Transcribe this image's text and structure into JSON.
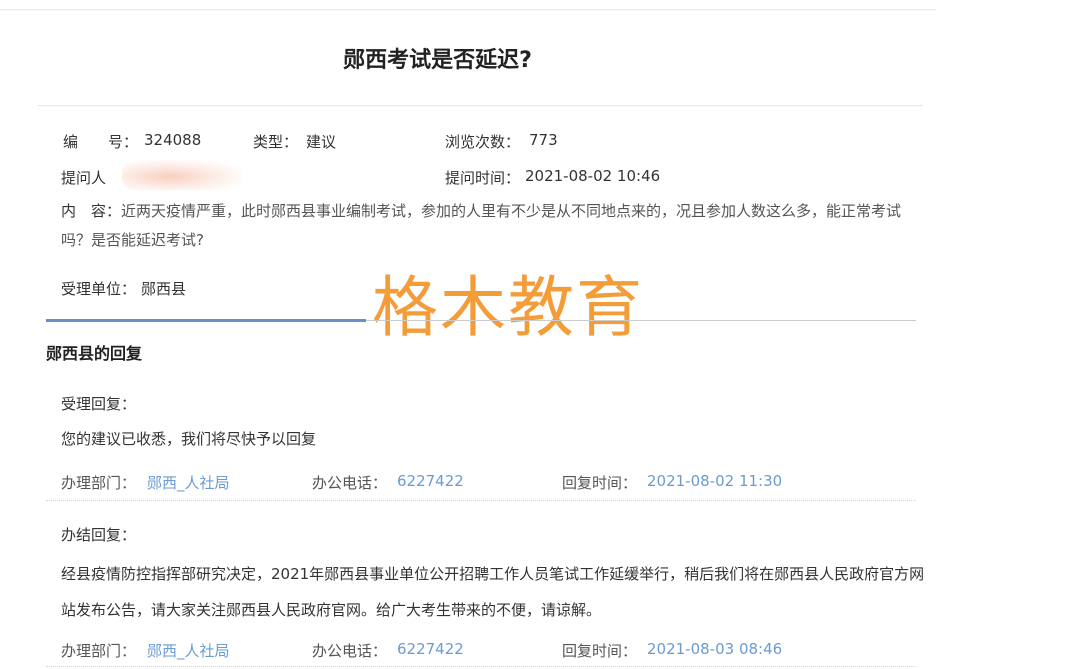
{
  "title": "郧西考试是否延迟?",
  "meta": {
    "id_label": "编　　号：",
    "id_value": "324088",
    "type_label": "类型：",
    "type_value": "建议",
    "views_label": "浏览次数：",
    "views_value": "773",
    "asker_label": "提问人",
    "time_label": "提问时间：",
    "time_value": "2021-08-02 10:46",
    "content_label": "内　容：",
    "content_value": "近两天疫情严重，此时郧西县事业编制考试，参加的人里有不少是从不同地点来的，况且参加人数这么多，能正常考试吗？是否能延迟考试?",
    "unit_label": "受理单位：",
    "unit_value": "郧西县"
  },
  "watermark": "格木教育",
  "reply": {
    "heading": "郧西县的回复",
    "accept": {
      "label": "受理回复：",
      "text": "您的建议已收悉，我们将尽快予以回复",
      "dept_label": "办理部门：",
      "dept_value": "郧西_人社局",
      "phone_label": "办公电话：",
      "phone_value": "6227422",
      "time_label": "回复时间：",
      "time_value": "2021-08-02 11:30"
    },
    "final": {
      "label": "办结回复：",
      "text": "经县疫情防控指挥部研究决定，2021年郧西县事业单位公开招聘工作人员笔试工作延缓举行，稍后我们将在郧西县人民政府官方网站发布公告，请大家关注郧西县人民政府官网。给广大考生带来的不便，请谅解。",
      "dept_label": "办理部门：",
      "dept_value": "郧西_人社局",
      "phone_label": "办公电话：",
      "phone_value": "6227422",
      "time_label": "回复时间：",
      "time_value": "2021-08-03 08:46"
    }
  },
  "colors": {
    "link": "#6b9bd2",
    "watermark": "#f39c38",
    "divider_accent": "#6a8fc4"
  }
}
